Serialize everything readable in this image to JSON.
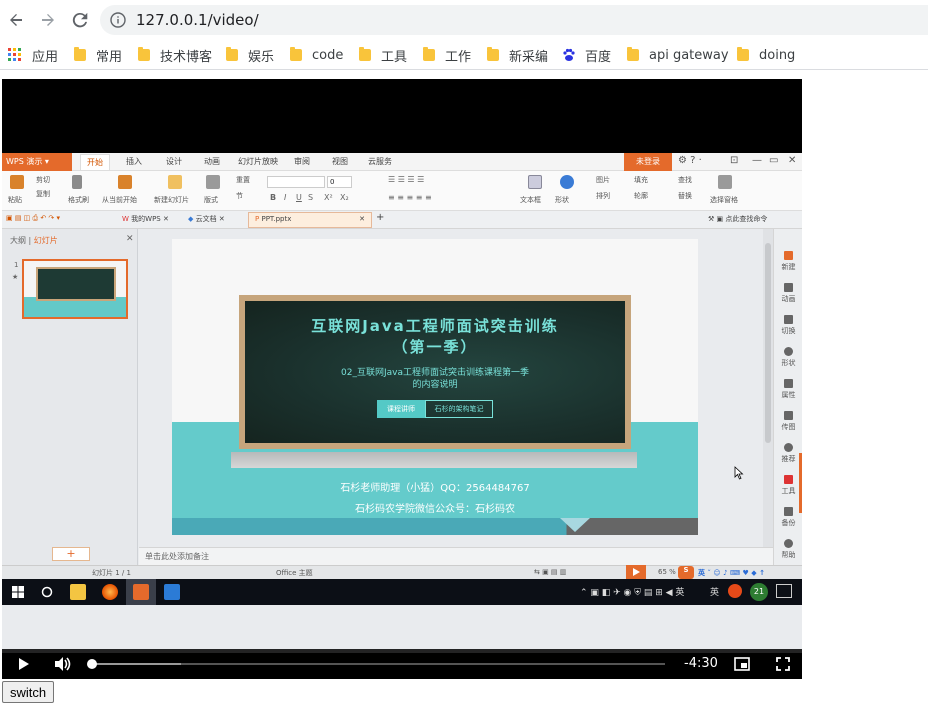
{
  "browser": {
    "url": "127.0.0.1/video/",
    "bookmarks": [
      {
        "label": "应用",
        "icon": "apps-grid-icon"
      },
      {
        "label": "常用",
        "icon": "folder-icon"
      },
      {
        "label": "技术博客",
        "icon": "folder-icon"
      },
      {
        "label": "娱乐",
        "icon": "folder-icon"
      },
      {
        "label": "code",
        "icon": "folder-icon"
      },
      {
        "label": "工具",
        "icon": "folder-icon"
      },
      {
        "label": "工作",
        "icon": "folder-icon"
      },
      {
        "label": "新采编",
        "icon": "folder-icon"
      },
      {
        "label": "百度",
        "icon": "baidu-paw-icon"
      },
      {
        "label": "api gateway",
        "icon": "folder-icon"
      },
      {
        "label": "doing",
        "icon": "folder-icon"
      }
    ]
  },
  "wps": {
    "app_label": "WPS 演示",
    "menu_tabs": [
      "开始",
      "插入",
      "设计",
      "动画",
      "幻灯片放映",
      "审阅",
      "视图",
      "云服务"
    ],
    "login_label": "未登录",
    "ribbon": {
      "paste": "粘贴",
      "cut": "剪切",
      "copy": "复制",
      "format_painter": "格式刷",
      "play_from_current": "从当前开始",
      "new_slide": "新建幻灯片",
      "layout": "版式",
      "section": "节",
      "reset": "重置",
      "font_size": "0",
      "textbox": "文本框",
      "shape": "形状",
      "picture": "图片",
      "fill": "填充",
      "arrange": "排列",
      "outline": "轮廓",
      "find": "查找",
      "replace": "替换",
      "select_pane": "选择窗格"
    },
    "doc_tabs": [
      "我的WPS",
      "云文档",
      "PPT.pptx"
    ],
    "search_cmd": "点此查找命令",
    "left_pane": {
      "outline_tab": "大纲",
      "slides_tab": "幻灯片",
      "slide_number": "1"
    },
    "slide": {
      "title": "互联网Java工程师面试突击训练",
      "subtitle": "（第一季）",
      "desc_line1": "02_互联网Java工程师面试突击训练课程第一季",
      "desc_line2": "的内容说明",
      "btn1": "课程讲师",
      "btn2": "石杉的架构笔记",
      "footer_line1": "石杉老师助理（小猛）QQ：2564484767",
      "footer_line2": "石杉码农学院微信公众号：石杉码农"
    },
    "task_pane": [
      "新建",
      "动画",
      "切换",
      "形状",
      "属性",
      "传图",
      "推荐",
      "工具",
      "备份",
      "帮助"
    ],
    "notes_hint": "单击此处添加备注",
    "status": {
      "slide_count": "幻灯片 1 / 1",
      "theme": "Office 主题",
      "zoom": "65 %"
    }
  },
  "taskbar": {
    "tray_lang": "英",
    "tray_ime": "英",
    "tray_badge": "21"
  },
  "player": {
    "time_remaining": "-4:30",
    "progress": 0.0,
    "buffered": 0.155
  },
  "switch_label": "switch"
}
